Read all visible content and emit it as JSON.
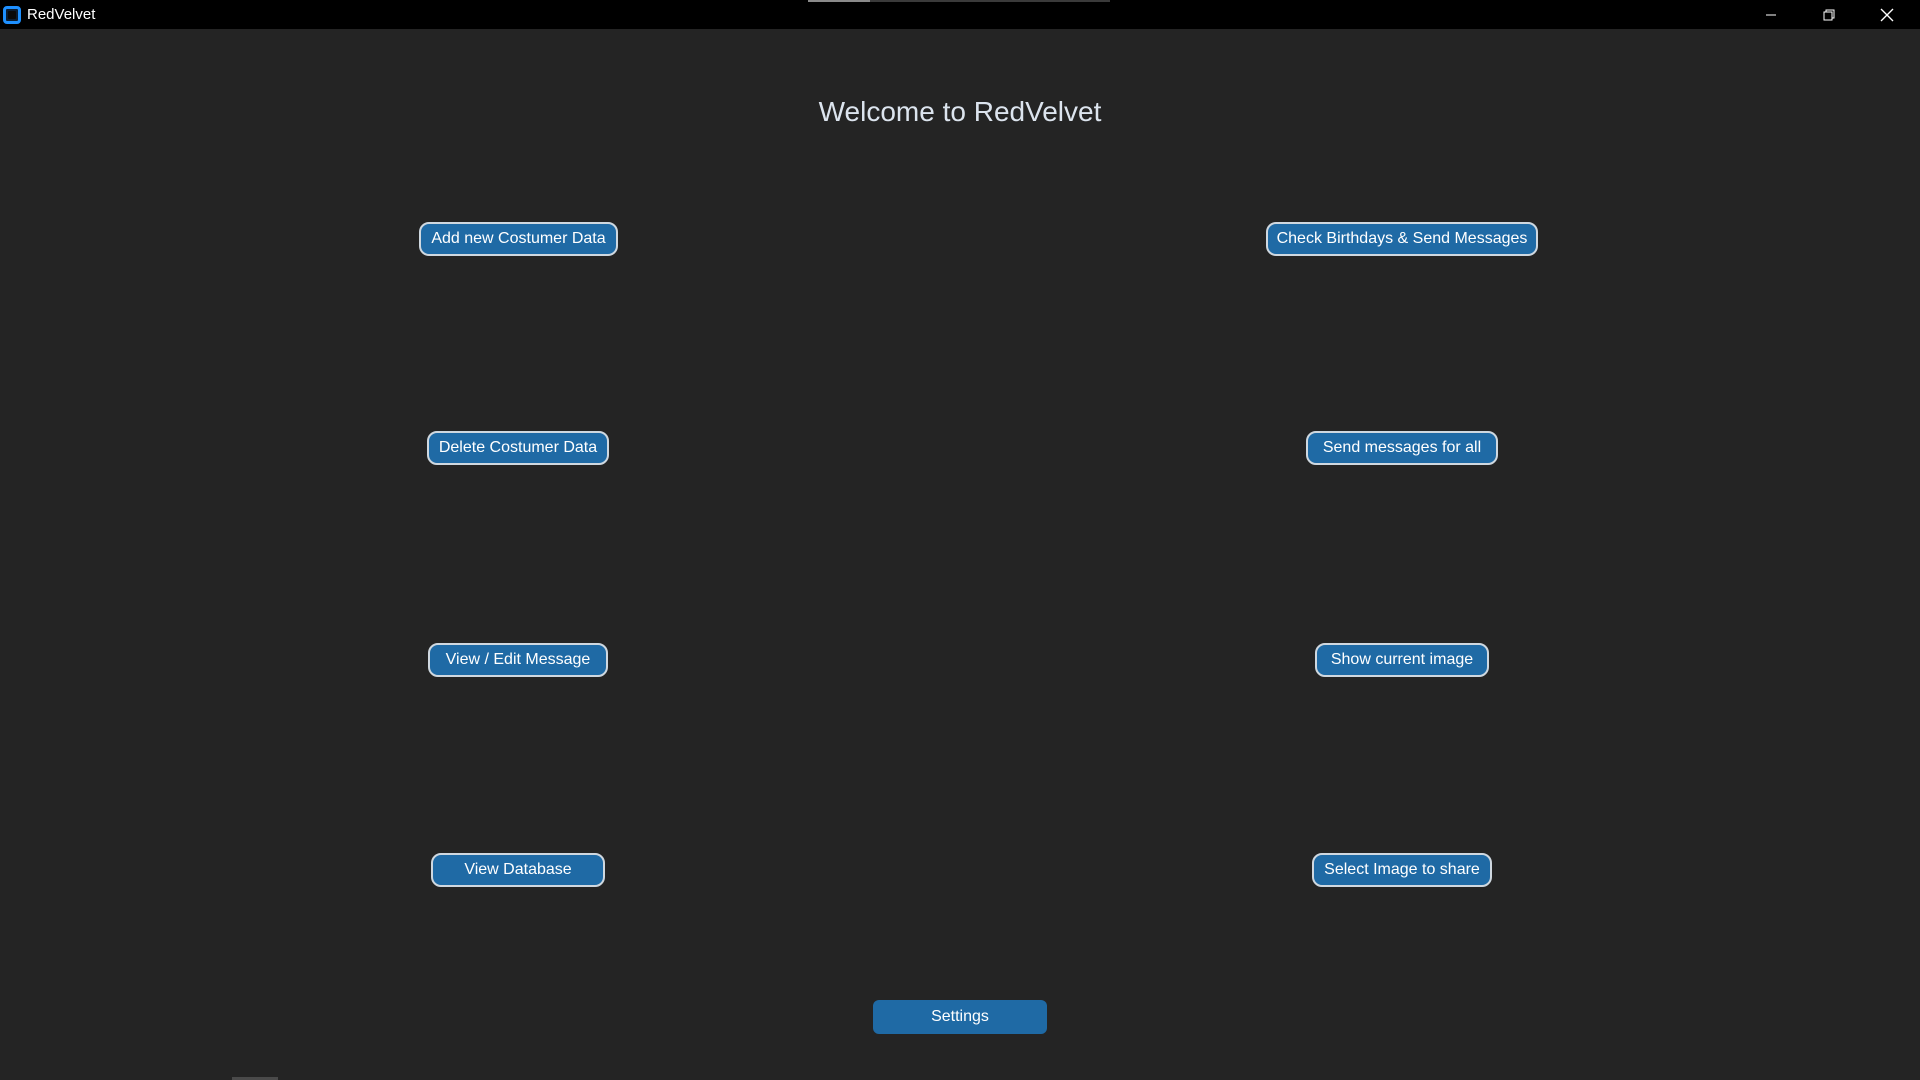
{
  "window": {
    "title": "RedVelvet",
    "app_icon": "app-logo-icon",
    "controls": {
      "minimize": "minimize-icon",
      "maximize": "restore-icon",
      "close": "close-icon"
    }
  },
  "main": {
    "heading": "Welcome to RedVelvet",
    "left_column": {
      "add_customer": "Add new Costumer Data",
      "delete_customer": "Delete Costumer Data",
      "edit_message": "View / Edit Message",
      "view_database": "View Database"
    },
    "right_column": {
      "check_birthdays": "Check Birthdays & Send Messages",
      "send_all": "Send messages for all",
      "show_image": "Show current image",
      "select_image": "Select Image to share"
    },
    "settings": "Settings"
  },
  "colors": {
    "background": "#242424",
    "titlebar": "#000000",
    "button": "#1f6aa5",
    "button_border": "#cfd8e0",
    "heading_text": "#dce4ee"
  }
}
